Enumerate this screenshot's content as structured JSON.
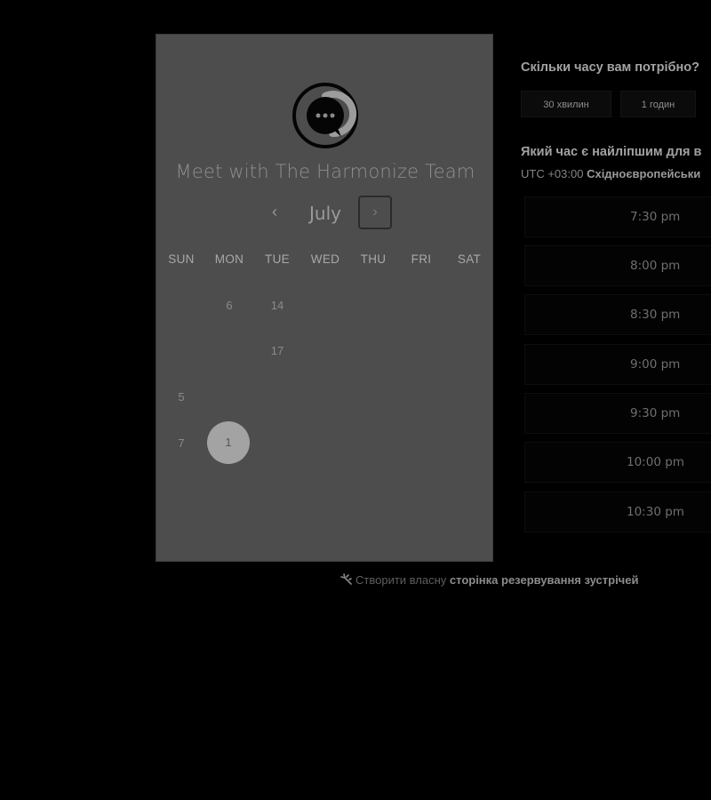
{
  "booking": {
    "title": "Meet with The Harmonize Team",
    "month": "July",
    "weekdays": [
      "SUN",
      "MON",
      "TUE",
      "WED",
      "THU",
      "FRI",
      "SAT"
    ],
    "days": [
      "6",
      "14",
      "17",
      "5",
      "7",
      "1"
    ],
    "selected_day": "1",
    "prev_icon": "chevron-left-icon",
    "next_icon": "chevron-right-icon"
  },
  "duration": {
    "question": "Скільки часу вам потрібно?",
    "options": [
      "30 хвилин",
      "1 годин"
    ]
  },
  "times": {
    "question": "Який час є найліпшим для в",
    "tz_offset": "UTC +03:00",
    "tz_name": "Східноєвропейськи",
    "slots": [
      "7:30 pm",
      "8:00 pm",
      "8:30 pm",
      "9:00 pm",
      "9:30 pm",
      "10:00 pm",
      "10:30 pm"
    ]
  },
  "footer": {
    "prefix": "Створити власну",
    "link": "сторінка резервування зустрічей",
    "icon": "sparkle-icon"
  },
  "colors": {
    "background": "#000000",
    "card": "#4d4d4d",
    "selected_day": "#a3a3a3"
  }
}
